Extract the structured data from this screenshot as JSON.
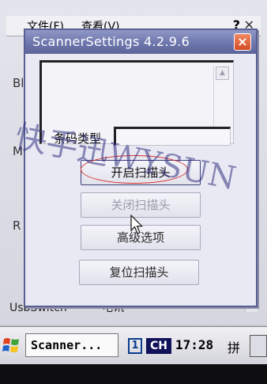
{
  "background": {
    "menu": [
      "文件(F)",
      "查看(V)"
    ],
    "labels": [
      "Blu",
      "M",
      "R"
    ],
    "bottom_left": "UsbSwitch",
    "bottom_right": "电讯"
  },
  "dialog": {
    "title": "ScannerSettings 4.2.9.6",
    "close_glyph": "×",
    "barcode_type_label": "条码类型",
    "barcode_type_value": "",
    "buttons": {
      "open": "开启扫描头",
      "close": "关闭扫描头",
      "advanced": "高级选项",
      "reset": "复位扫描头"
    },
    "watermark": "快手迅WYSUN"
  },
  "taskbar": {
    "task_label": "Scanner...",
    "keyboard_indicator": "1",
    "language": "CH",
    "time": "17:28",
    "ime": "拼"
  },
  "colors": {
    "titlebar": "#6e77ad",
    "close_button": "#d24a22",
    "highlight_ellipse": "#d8302c",
    "language_badge": "#10125a"
  }
}
